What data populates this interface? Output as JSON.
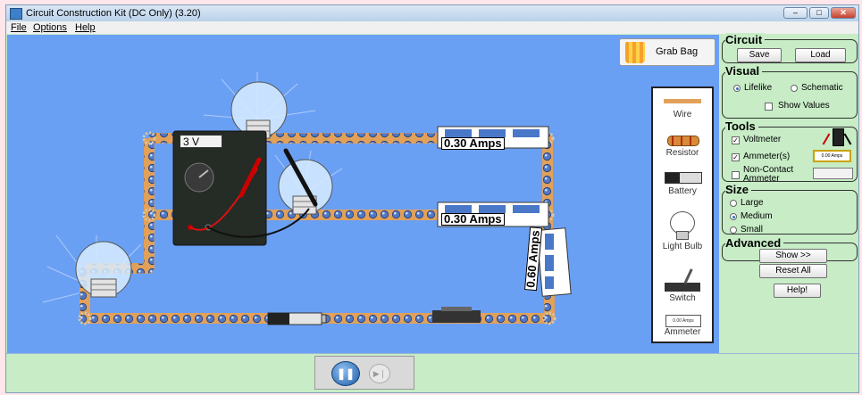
{
  "window": {
    "title": "Circuit Construction Kit (DC Only) (3.20)",
    "controls": {
      "minimize": "–",
      "maximize": "□",
      "close": "✕"
    }
  },
  "menu": [
    "File",
    "Options",
    "Help"
  ],
  "canvas": {
    "grab_bag": "Grab Bag",
    "voltmeter_reading": "3 V",
    "current_labels": [
      "0.30 Amps",
      "0.30 Amps",
      "0.60 Amps"
    ]
  },
  "toolbox": {
    "items": [
      "Wire",
      "Resistor",
      "Battery",
      "Light Bulb",
      "Switch",
      "Ammeter"
    ],
    "mini_ammeter_text": "0.00 Amps"
  },
  "playback": {
    "pause_icon": "❚❚",
    "step_icon": "▶❘"
  },
  "panel": {
    "circuit": {
      "title": "Circuit",
      "save": "Save",
      "load": "Load"
    },
    "visual": {
      "title": "Visual",
      "options": [
        "Lifelike",
        "Schematic"
      ],
      "selected": "Lifelike",
      "show_values": "Show Values",
      "show_values_checked": false
    },
    "tools": {
      "title": "Tools",
      "voltmeter": "Voltmeter",
      "voltmeter_checked": true,
      "ammeter": "Ammeter(s)",
      "ammeter_checked": true,
      "non_contact_ammeter": "Non-Contact Ammeter",
      "non_contact_checked": false,
      "ammeter_icon_text": "0.00 Amps"
    },
    "size": {
      "title": "Size",
      "options": [
        "Large",
        "Medium",
        "Small"
      ],
      "selected": "Medium"
    },
    "advanced": {
      "title": "Advanced",
      "show": "Show >>",
      "reset": "Reset All",
      "help": "Help!"
    }
  },
  "colors": {
    "canvas": "#6aa0f4",
    "panel": "#c7ecc6",
    "wire": "#e1a15a",
    "bead": "#4f78c4"
  }
}
